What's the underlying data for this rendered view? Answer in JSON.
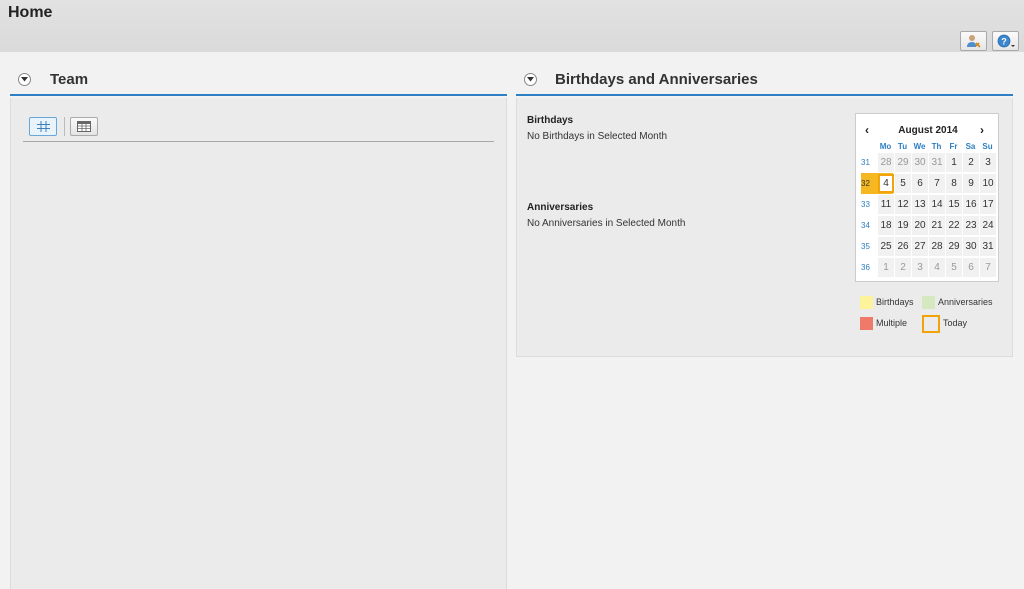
{
  "page": {
    "title": "Home"
  },
  "colors": {
    "accent": "#2f7fc5",
    "birthdays": "#fdf39a",
    "anniversaries": "#d6e8bf",
    "multiple": "#f07a6a",
    "today": "#f0a30a"
  },
  "toolbar": {
    "personalize_icon": "person-settings-icon",
    "help_icon": "help-icon"
  },
  "team": {
    "title": "Team",
    "views": [
      {
        "icon": "grid-view-icon",
        "active": true
      },
      {
        "icon": "table-view-icon",
        "active": false
      }
    ]
  },
  "birthdays_panel": {
    "title": "Birthdays and Anniversaries",
    "birthdays_heading": "Birthdays",
    "birthdays_text": "No Birthdays in Selected Month",
    "anniversaries_heading": "Anniversaries",
    "anniversaries_text": "No Anniversaries in Selected Month",
    "calendar": {
      "month_label": "August 2014",
      "prev": "‹",
      "next": "›",
      "weekdays": [
        "Mo",
        "Tu",
        "We",
        "Th",
        "Fr",
        "Sa",
        "Su"
      ],
      "weeks": [
        {
          "week": "31",
          "days": [
            "28",
            "29",
            "30",
            "31",
            "1",
            "2",
            "3"
          ],
          "other_month": [
            true,
            true,
            true,
            true,
            false,
            false,
            false
          ]
        },
        {
          "week": "32",
          "days": [
            "4",
            "5",
            "6",
            "7",
            "8",
            "9",
            "10"
          ],
          "other_month": [
            false,
            false,
            false,
            false,
            false,
            false,
            false
          ],
          "selected": true,
          "today_index": 0
        },
        {
          "week": "33",
          "days": [
            "11",
            "12",
            "13",
            "14",
            "15",
            "16",
            "17"
          ],
          "other_month": [
            false,
            false,
            false,
            false,
            false,
            false,
            false
          ]
        },
        {
          "week": "34",
          "days": [
            "18",
            "19",
            "20",
            "21",
            "22",
            "23",
            "24"
          ],
          "other_month": [
            false,
            false,
            false,
            false,
            false,
            false,
            false
          ]
        },
        {
          "week": "35",
          "days": [
            "25",
            "26",
            "27",
            "28",
            "29",
            "30",
            "31"
          ],
          "other_month": [
            false,
            false,
            false,
            false,
            false,
            false,
            false
          ]
        },
        {
          "week": "36",
          "days": [
            "1",
            "2",
            "3",
            "4",
            "5",
            "6",
            "7"
          ],
          "other_month": [
            true,
            true,
            true,
            true,
            true,
            true,
            true
          ]
        }
      ]
    },
    "legend": {
      "birthdays": "Birthdays",
      "anniversaries": "Anniversaries",
      "multiple": "Multiple",
      "today": "Today"
    }
  }
}
